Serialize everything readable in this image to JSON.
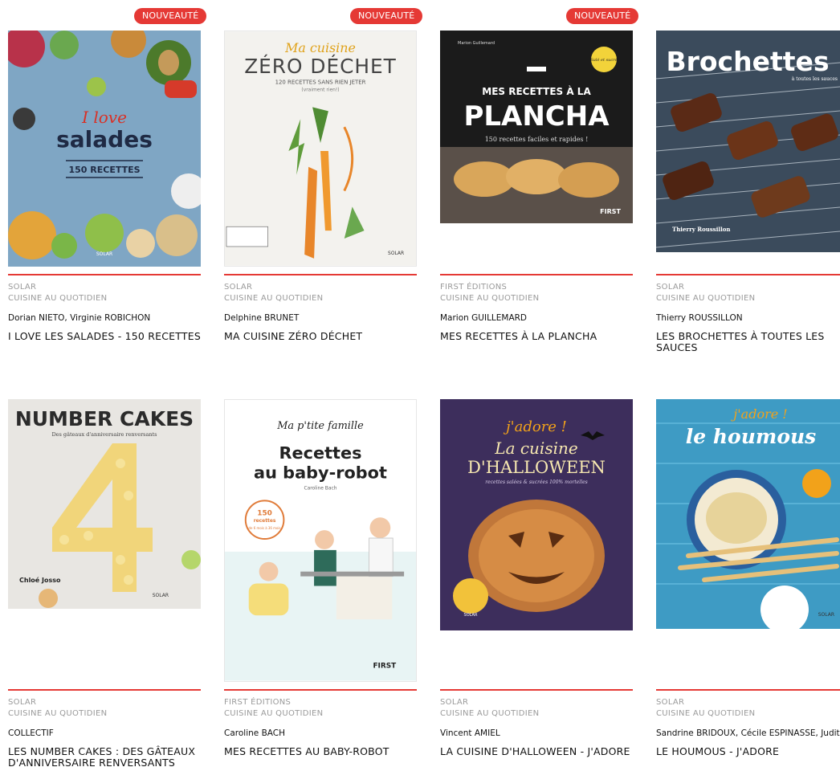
{
  "badge_label": "NOUVEAUTÉ",
  "books": [
    {
      "publisher": "SOLAR",
      "collection": "CUISINE AU QUOTIDIEN",
      "authors": "Dorian NIETO, Virginie ROBICHON",
      "title": "I LOVE LES SALADES - 150 RECETTES",
      "is_new": true,
      "cover": {
        "line1": "I love",
        "line2": "salades",
        "line3": "150 RECETTES",
        "imprint": "SOLAR"
      }
    },
    {
      "publisher": "SOLAR",
      "collection": "CUISINE AU QUOTIDIEN",
      "authors": "Delphine BRUNET",
      "title": "MA CUISINE ZÉRO DÉCHET",
      "is_new": true,
      "cover": {
        "line1": "Ma cuisine",
        "line2": "ZÉRO DÉCHET",
        "line3": "120 RECETTES SANS RIEN JETER",
        "line4": "(vraiment rien!)",
        "imprint": "SOLAR"
      }
    },
    {
      "publisher": "FIRST ÉDITIONS",
      "collection": "CUISINE AU QUOTIDIEN",
      "authors": "Marion GUILLEMARD",
      "title": "MES RECETTES À LA PLANCHA",
      "is_new": true,
      "cover": {
        "author": "Marion Guillemard",
        "line1": "MES RECETTES À LA",
        "line2": "PLANCHA",
        "line3": "150 recettes faciles et rapides !",
        "sticker": "Salé et sucré",
        "imprint": "FIRST"
      }
    },
    {
      "publisher": "SOLAR",
      "collection": "CUISINE AU QUOTIDIEN",
      "authors": "Thierry ROUSSILLON",
      "title": "LES BROCHETTES À TOUTES LES SAUCES",
      "is_new": false,
      "cover": {
        "line1": "Brochettes",
        "line2": "à toutes les sauces",
        "author": "Thierry Roussillon"
      }
    },
    {
      "publisher": "SOLAR",
      "collection": "CUISINE AU QUOTIDIEN",
      "authors": "COLLECTIF",
      "title": "LES NUMBER CAKES : DES GÂTEAUX D'ANNIVERSAIRE RENVERSANTS",
      "is_new": false,
      "cover": {
        "line1": "NUMBER CAKES",
        "line2": "Des gâteaux d'anniversaire renversants",
        "author": "Chloé Josso",
        "imprint": "SOLAR"
      }
    },
    {
      "publisher": "FIRST ÉDITIONS",
      "collection": "CUISINE AU QUOTIDIEN",
      "authors": "Caroline BACH",
      "title": "MES RECETTES AU BABY-ROBOT",
      "is_new": false,
      "cover": {
        "line1": "Ma p'tite famille",
        "line2": "Recettes",
        "line3": "au baby-robot",
        "author": "Caroline Bach",
        "sticker1": "150",
        "sticker2": "recettes",
        "sticker3": "de 6 mois à 36 mois",
        "imprint": "FIRST"
      }
    },
    {
      "publisher": "SOLAR",
      "collection": "CUISINE AU QUOTIDIEN",
      "authors": "Vincent AMIEL",
      "title": "LA CUISINE D'HALLOWEEN - J'ADORE",
      "is_new": false,
      "cover": {
        "line1": "j'adore !",
        "line2": "La cuisine",
        "line3": "D'HALLOWEEN",
        "line4": "recettes salées & sucrées 100% mortelles",
        "imprint": "SOLAR"
      }
    },
    {
      "publisher": "SOLAR",
      "collection": "CUISINE AU QUOTIDIEN",
      "authors": "Sandrine BRIDOUX, Cécile ESPINASSE, Judith S...",
      "title": "LE HOUMOUS - J'ADORE",
      "is_new": false,
      "cover": {
        "line1": "j'adore !",
        "line2": "le houmous",
        "imprint": "SOLAR"
      }
    }
  ]
}
